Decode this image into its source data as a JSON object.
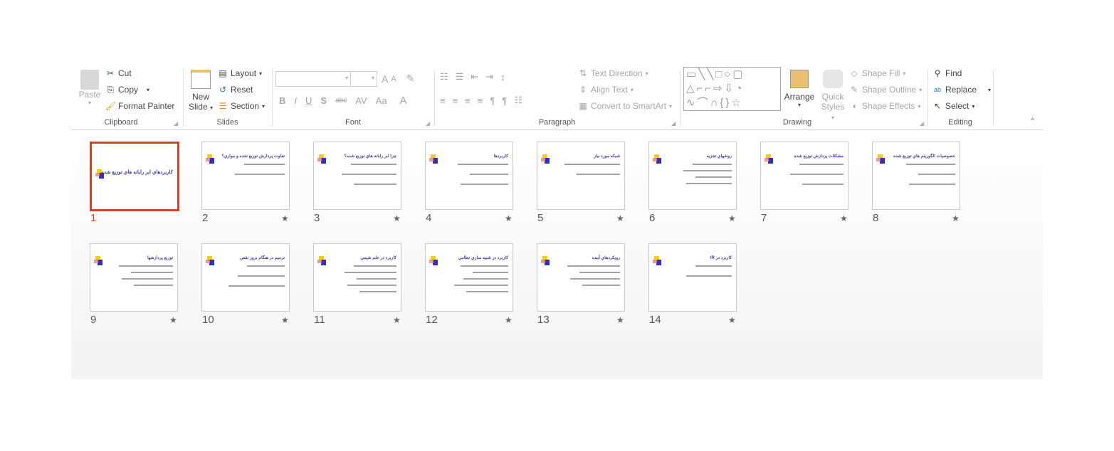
{
  "ribbon": {
    "clipboard": {
      "paste": "Paste",
      "cut": "Cut",
      "copy": "Copy",
      "format_painter": "Format Painter",
      "label": "Clipboard"
    },
    "slides": {
      "new_slide_1": "New",
      "new_slide_2": "Slide",
      "layout": "Layout",
      "reset": "Reset",
      "section": "Section",
      "label": "Slides"
    },
    "font": {
      "label": "Font",
      "bold": "B",
      "italic": "I",
      "underline": "U",
      "shadow": "S",
      "strike": "abc",
      "spacing": "AV",
      "case": "Aa",
      "color": "A",
      "grow": "A",
      "shrink": "A"
    },
    "paragraph": {
      "label": "Paragraph",
      "text_direction": "Text Direction",
      "align_text": "Align Text",
      "convert_smartart": "Convert to SmartArt"
    },
    "drawing": {
      "label": "Drawing",
      "arrange": "Arrange",
      "quick_1": "Quick",
      "quick_2": "Styles",
      "shape_fill": "Shape Fill",
      "shape_outline": "Shape Outline",
      "shape_effects": "Shape Effects"
    },
    "editing": {
      "label": "Editing",
      "find": "Find",
      "replace": "Replace",
      "select": "Select"
    }
  },
  "colors": {
    "selection": "#c7472b",
    "title": "#4040a0"
  },
  "slides": [
    {
      "number": "1",
      "title": "کاربردهاي ابر رايانه هاي توزيع شده",
      "selected": true,
      "has_transition": false
    },
    {
      "number": "2",
      "title": "تفاوت پردازش توزيع شده و موازي؟",
      "has_transition": true
    },
    {
      "number": "3",
      "title": "چرا ابر رايانه هاي توزيع شده؟",
      "has_transition": true
    },
    {
      "number": "4",
      "title": "کاربردها",
      "has_transition": true
    },
    {
      "number": "5",
      "title": "شبکه مورد نياز",
      "has_transition": true
    },
    {
      "number": "6",
      "title": "روشهاي تجزيه",
      "has_transition": true
    },
    {
      "number": "7",
      "title": "مشکلات پردازش توزيع شده",
      "has_transition": true
    },
    {
      "number": "8",
      "title": "خصوصيات الگوريتم هاي توزيع شده",
      "has_transition": true
    },
    {
      "number": "9",
      "title": "توزيع پردازشها",
      "has_transition": true
    },
    {
      "number": "10",
      "title": "ترميم در هنگام بروز نقص",
      "has_transition": true
    },
    {
      "number": "11",
      "title": "کاربرد در علم شيمي",
      "has_transition": true
    },
    {
      "number": "12",
      "title": "کاربرد در شبيه سازي نظامي",
      "has_transition": true
    },
    {
      "number": "13",
      "title": "رويکردهاي آينده",
      "has_transition": true
    },
    {
      "number": "14",
      "title": "کاربرد در IR",
      "has_transition": true
    }
  ],
  "transition_icon": "star-icon"
}
